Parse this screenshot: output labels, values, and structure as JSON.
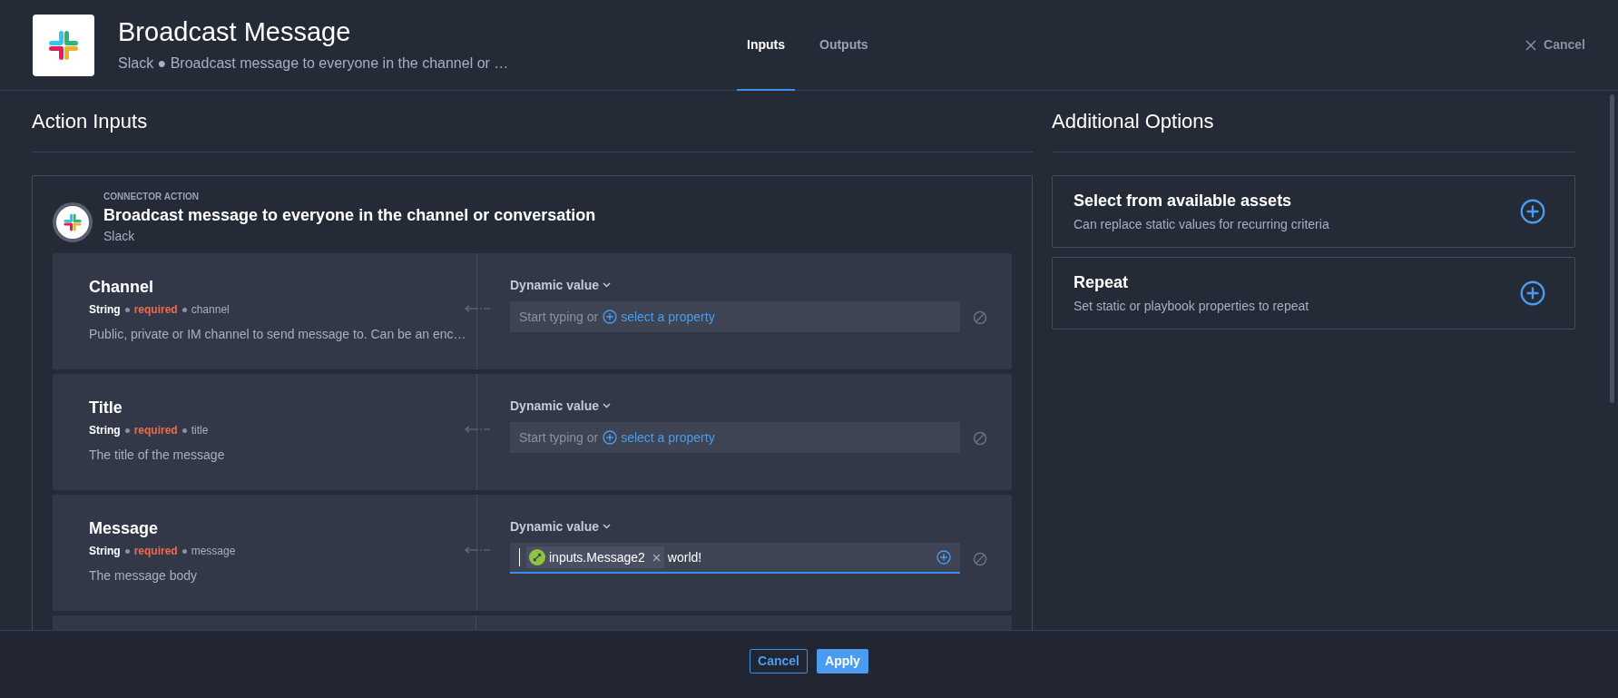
{
  "header": {
    "title": "Broadcast Message",
    "subtitle": "Slack ● Broadcast message to everyone in the channel or …",
    "cancel": "Cancel"
  },
  "tabs": [
    {
      "label": "Inputs",
      "selected": true
    },
    {
      "label": "Outputs",
      "selected": false
    }
  ],
  "action_inputs": {
    "heading": "Action Inputs",
    "eyebrow": "CONNECTOR ACTION",
    "title": "Broadcast message to everyone in the channel or conversation",
    "app": "Slack",
    "fields": [
      {
        "name": "Channel",
        "type": "String",
        "required": "required",
        "key": "channel",
        "description": "Public, private or IM channel to send message to. Can be an enc…",
        "mode": "Dynamic value",
        "input": {
          "kind": "empty",
          "placeholder": "Start typing or",
          "link": "select a property"
        }
      },
      {
        "name": "Title",
        "type": "String",
        "required": "required",
        "key": "title",
        "description": "The title of the message",
        "mode": "Dynamic value",
        "input": {
          "kind": "empty",
          "placeholder": "Start typing or",
          "link": "select a property"
        }
      },
      {
        "name": "Message",
        "type": "String",
        "required": "required",
        "key": "message",
        "description": "The message body",
        "mode": "Dynamic value",
        "input": {
          "kind": "token",
          "token": "inputs.Message2",
          "text": "world!",
          "focused": true
        }
      }
    ]
  },
  "additional_options": {
    "heading": "Additional Options",
    "items": [
      {
        "title": "Select from available assets",
        "description": "Can replace static values for recurring criteria"
      },
      {
        "title": "Repeat",
        "description": "Set static or playbook properties to repeat"
      }
    ]
  },
  "footer": {
    "buttons": [
      {
        "label": "Cancel",
        "kind": "outline"
      },
      {
        "label": "Apply",
        "kind": "primary"
      }
    ]
  }
}
